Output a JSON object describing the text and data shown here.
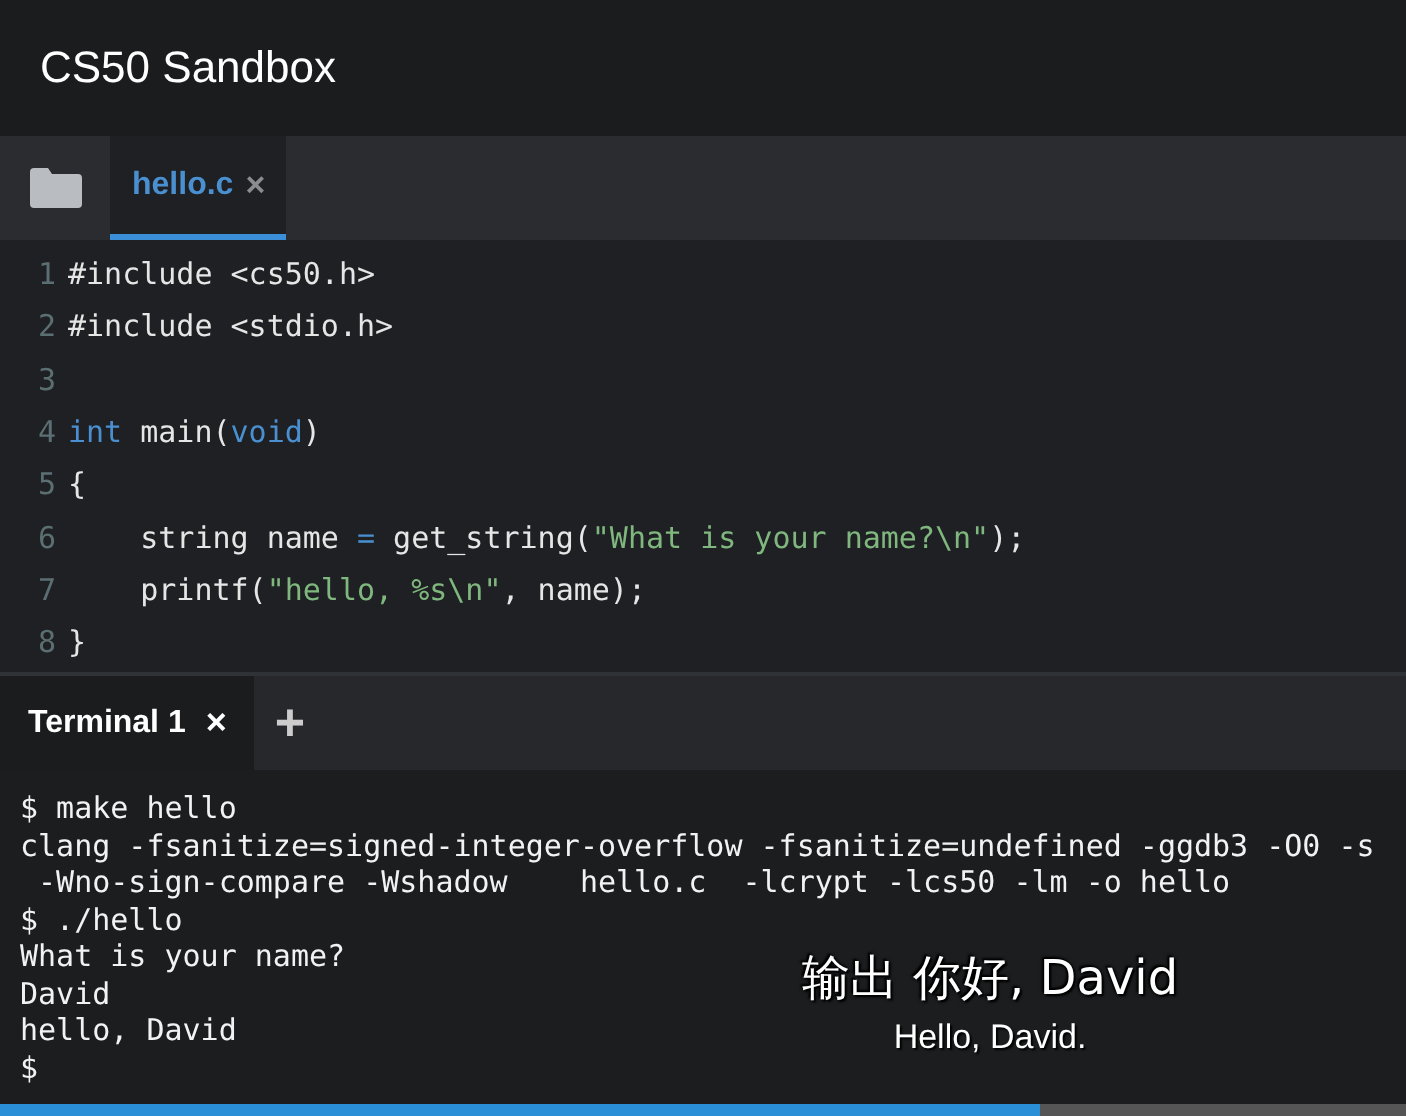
{
  "window": {
    "title": "CS50 Sandbox"
  },
  "editor_tabs": [
    {
      "label": "hello.c",
      "close": "×",
      "selected": true
    }
  ],
  "code_lines": [
    {
      "number": "1",
      "tokens": [
        {
          "kind": "plain",
          "text": "#include <cs50.h>"
        }
      ]
    },
    {
      "number": "2",
      "tokens": [
        {
          "kind": "plain",
          "text": "#include <stdio.h>"
        }
      ]
    },
    {
      "number": "3"
    },
    {
      "number": "4",
      "tokens": [
        {
          "kind": "keyword",
          "text": "int"
        },
        {
          "kind": "plain",
          "text": " main("
        },
        {
          "kind": "keyword",
          "text": "void"
        },
        {
          "kind": "plain",
          "text": ")"
        }
      ]
    },
    {
      "number": "5",
      "tokens": [
        {
          "kind": "plain",
          "text": "{"
        }
      ]
    },
    {
      "number": "6",
      "tokens": [
        {
          "kind": "plain",
          "text": "    string name "
        },
        {
          "kind": "keyword",
          "text": "="
        },
        {
          "kind": "plain",
          "text": " get_string("
        },
        {
          "kind": "string",
          "text": "\"What is your name?\\n\""
        },
        {
          "kind": "plain",
          "text": ");"
        }
      ]
    },
    {
      "number": "7",
      "tokens": [
        {
          "kind": "plain",
          "text": "    printf("
        },
        {
          "kind": "string",
          "text": "\"hello, %s\\n\""
        },
        {
          "kind": "plain",
          "text": ", name);"
        }
      ]
    },
    {
      "number": "8",
      "tokens": [
        {
          "kind": "plain",
          "text": "}"
        }
      ]
    }
  ],
  "terminal_tabs": [
    {
      "label": "Terminal 1",
      "close": "×",
      "selected": true
    }
  ],
  "new_terminal": "+",
  "terminal_lines": [
    "$ make hello",
    "clang -fsanitize=signed-integer-overflow -fsanitize=undefined -ggdb3 -O0 -s",
    " -Wno-sign-compare -Wshadow    hello.c  -lcrypt -lcs50 -lm -o hello",
    "$ ./hello",
    "What is your name?",
    "David",
    "hello, David",
    "$"
  ],
  "subtitles": [
    "输出 你好, David",
    "Hello, David."
  ]
}
